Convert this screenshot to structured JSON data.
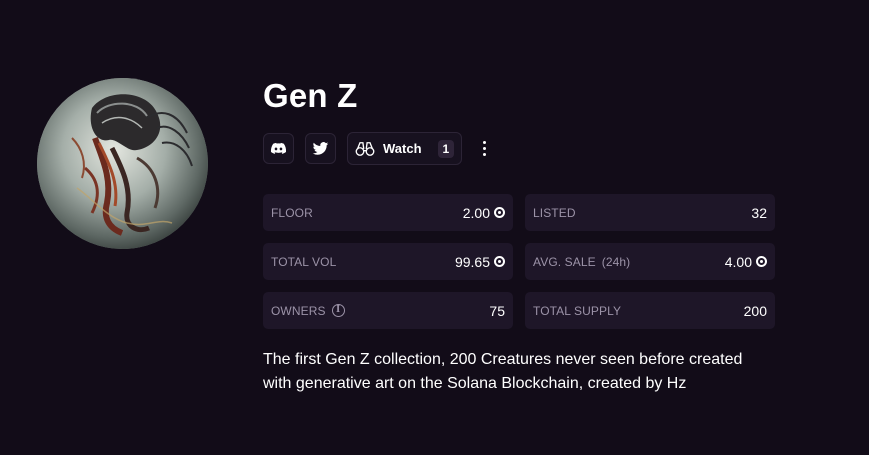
{
  "collection": {
    "name": "Gen Z",
    "description_line1": "The first Gen Z collection, 200 Creatures never seen before created",
    "description_line2": "with generative art on the Solana Blockchain, created by Hz"
  },
  "social": {
    "discord_icon": "discord-icon",
    "twitter_icon": "twitter-icon",
    "watch_label": "Watch",
    "watch_count": "1",
    "watch_icon": "binoculars-icon"
  },
  "stats": {
    "floor": {
      "label": "FLOOR",
      "value": "2.00",
      "currency_icon": "sol-icon"
    },
    "listed": {
      "label": "LISTED",
      "value": "32"
    },
    "total_vol": {
      "label": "TOTAL VOL",
      "value": "99.65",
      "currency_icon": "sol-icon"
    },
    "avg_sale": {
      "label": "AVG. SALE",
      "label_suffix": "(24h)",
      "value": "4.00",
      "currency_icon": "sol-icon"
    },
    "owners": {
      "label": "OWNERS",
      "info_icon": "i",
      "value": "75"
    },
    "total_supply": {
      "label": "TOTAL SUPPLY",
      "value": "200"
    }
  },
  "colors": {
    "background": "#120c18",
    "card": "#1e1628",
    "label": "#9c93a8"
  }
}
